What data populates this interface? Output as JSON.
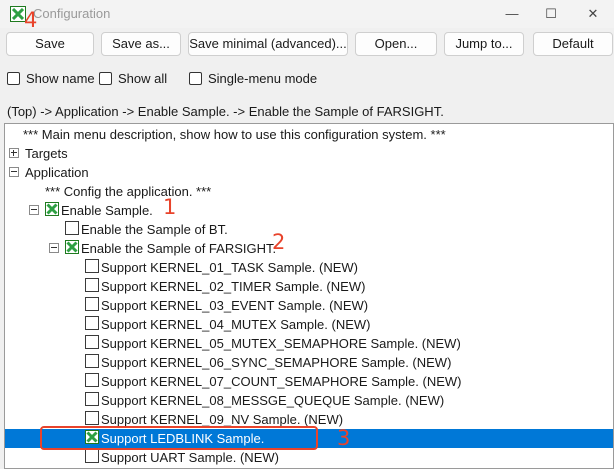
{
  "window": {
    "title": "Configuration",
    "controls": [
      "—",
      "☐",
      "✕"
    ]
  },
  "annotations": {
    "save": "4",
    "enable_sample": "1",
    "farsight": "2",
    "ledblink": "3"
  },
  "toolbar": {
    "save": "Save",
    "save_as": "Save as...",
    "save_minimal": "Save minimal (advanced)...",
    "open": "Open...",
    "jump_to": "Jump to...",
    "default": "Default"
  },
  "options": {
    "show_name": "Show name",
    "show_all": "Show all",
    "single_menu": "Single-menu mode"
  },
  "breadcrumb": "(Top) -> Application -> Enable Sample. -> Enable the Sample of FARSIGHT.",
  "tree": {
    "main_desc": "*** Main menu description, show how to use this configuration system. ***",
    "targets": "Targets",
    "application": "Application",
    "app_desc": "*** Config the application. ***",
    "enable_sample": "Enable Sample.",
    "enable_bt": "Enable the Sample of BT.",
    "enable_farsight": "Enable the Sample of FARSIGHT.",
    "items": [
      {
        "label": "Support KERNEL_01_TASK Sample. (NEW)",
        "checked": false
      },
      {
        "label": "Support KERNEL_02_TIMER Sample. (NEW)",
        "checked": false
      },
      {
        "label": "Support KERNEL_03_EVENT Sample. (NEW)",
        "checked": false
      },
      {
        "label": "Support KERNEL_04_MUTEX Sample. (NEW)",
        "checked": false
      },
      {
        "label": "Support KERNEL_05_MUTEX_SEMAPHORE Sample. (NEW)",
        "checked": false
      },
      {
        "label": "Support KERNEL_06_SYNC_SEMAPHORE Sample. (NEW)",
        "checked": false
      },
      {
        "label": "Support KERNEL_07_COUNT_SEMAPHORE Sample. (NEW)",
        "checked": false
      },
      {
        "label": "Support KERNEL_08_MESSGE_QUEQUE Sample. (NEW)",
        "checked": false
      },
      {
        "label": "Support KERNEL_09_NV Sample. (NEW)",
        "checked": false
      },
      {
        "label": "Support LEDBLINK Sample.",
        "checked": true,
        "selected": true
      },
      {
        "label": "Support UART Sample. (NEW)",
        "checked": false
      }
    ]
  },
  "colors": {
    "selection": "#0078d7",
    "annotation": "#e8432b",
    "check_green": "#2ea043"
  }
}
